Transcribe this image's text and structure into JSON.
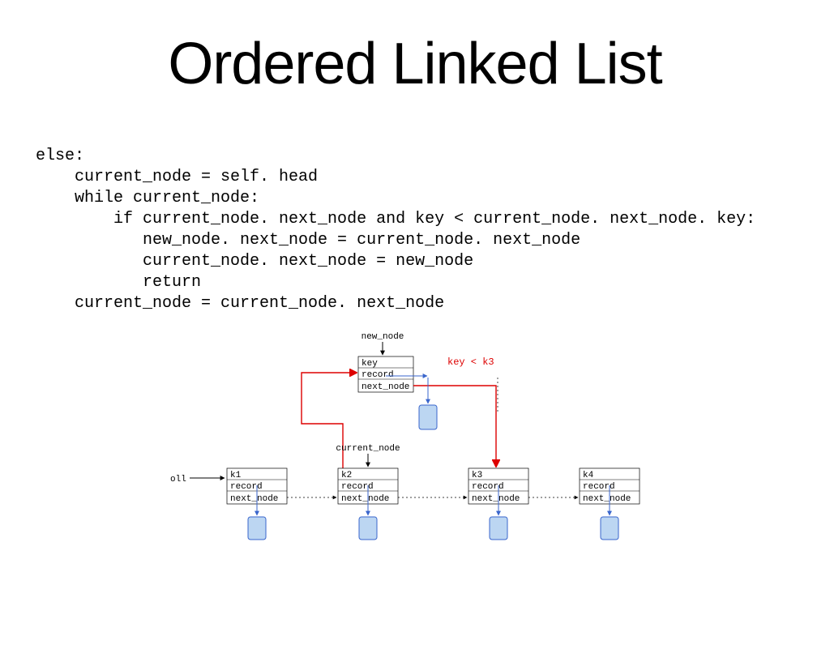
{
  "title": "Ordered Linked List",
  "code": "else:\n    current_node = self. head\n    while current_node:\n        if current_node. next_node and key < current_node. next_node. key:\n           new_node. next_node = current_node. next_node\n           current_node. next_node = new_node\n           return\n    current_node = current_node. next_node",
  "diagram": {
    "new_node_label": "new_node",
    "current_node_label": "current_node",
    "condition": "key < k3",
    "oll_label": "oll",
    "new_node_fields": [
      "key",
      "record",
      "next_node"
    ],
    "nodes": [
      {
        "key": "k1",
        "fields": [
          "k1",
          "record",
          "next_node"
        ]
      },
      {
        "key": "k2",
        "fields": [
          "k2",
          "record",
          "next_node"
        ]
      },
      {
        "key": "k3",
        "fields": [
          "k3",
          "record",
          "next_node"
        ]
      },
      {
        "key": "k4",
        "fields": [
          "k4",
          "record",
          "next_node"
        ]
      }
    ]
  }
}
